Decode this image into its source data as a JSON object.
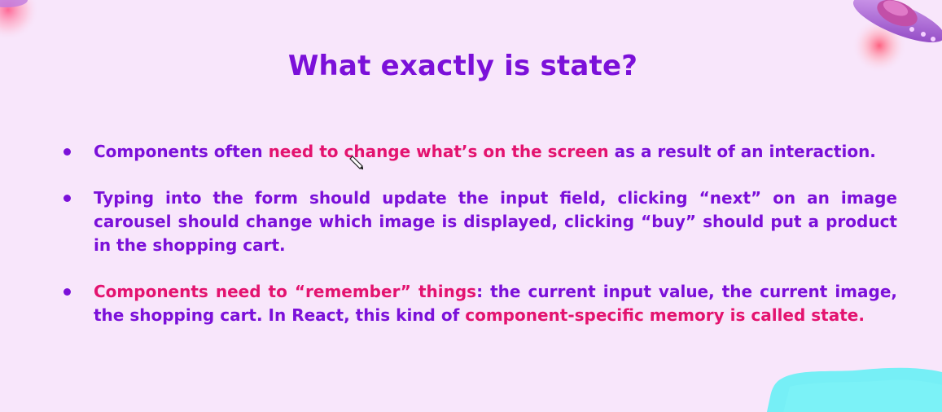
{
  "colors": {
    "background": "#f8e6fb",
    "primary_purple": "#7b10d9",
    "accent_pink": "#e3136f",
    "bullet_purple": "#7b10d9",
    "ufo_body": "#b06ad8",
    "ufo_glow": "#ff7aa0",
    "blob_cyan": "#5ff0f5"
  },
  "slide": {
    "title": "What exactly is state?",
    "bullets": [
      {
        "segments": [
          {
            "text": "Components often ",
            "color": "#7b10d9"
          },
          {
            "text": "need to change what’s on the screen",
            "color": "#e3136f"
          },
          {
            "text": " as a result of an interaction.",
            "color": "#7b10d9"
          }
        ]
      },
      {
        "segments": [
          {
            "text": "Typing into the form should update the input field, clicking “next” on an image carousel should change which image is displayed, clicking “buy” should put a product in the shopping cart.",
            "color": "#7b10d9"
          }
        ]
      },
      {
        "segments": [
          {
            "text": "Components need to “remember” things",
            "color": "#e3136f"
          },
          {
            "text": ": the current input value, the current image, the shopping cart. In React, this kind of ",
            "color": "#7b10d9"
          },
          {
            "text": "component-specific memory is called state.",
            "color": "#e3136f"
          }
        ]
      }
    ]
  },
  "decorations": {
    "top_left": "planet-glow-icon",
    "top_right": "ufo-icon",
    "bottom_right": "cyan-paint-blob",
    "cursor": "pen-cursor-icon"
  }
}
